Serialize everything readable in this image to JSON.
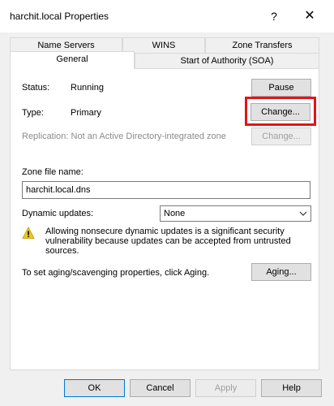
{
  "window": {
    "title": "harchit.local Properties",
    "help_glyph": "?",
    "close_glyph": "✕"
  },
  "tabs": {
    "row1": [
      "Name Servers",
      "WINS",
      "Zone Transfers"
    ],
    "row2": [
      "General",
      "Start of Authority (SOA)"
    ],
    "active": "General"
  },
  "general": {
    "status_label": "Status:",
    "status_value": "Running",
    "pause_button": "Pause",
    "type_label": "Type:",
    "type_value": "Primary",
    "change_type_button": "Change...",
    "replication_text": "Replication:  Not an Active Directory-integrated zone",
    "change_replication_button": "Change...",
    "zone_file_label": "Zone file name:",
    "zone_file_value": "harchit.local.dns",
    "dynamic_updates_label": "Dynamic updates:",
    "dynamic_updates_value": "None",
    "warning_text": "Allowing nonsecure dynamic updates is a significant security vulnerability because updates can be accepted from untrusted sources.",
    "aging_text": "To set aging/scavenging properties, click Aging.",
    "aging_button": "Aging..."
  },
  "footer": {
    "ok": "OK",
    "cancel": "Cancel",
    "apply": "Apply",
    "help": "Help"
  },
  "colors": {
    "highlight": "#e0151a",
    "warning_icon": "#f2c811"
  },
  "icons": {
    "warning": "warning-icon",
    "help": "help-icon",
    "close": "close-icon",
    "dropdown": "chevron-down-icon"
  }
}
